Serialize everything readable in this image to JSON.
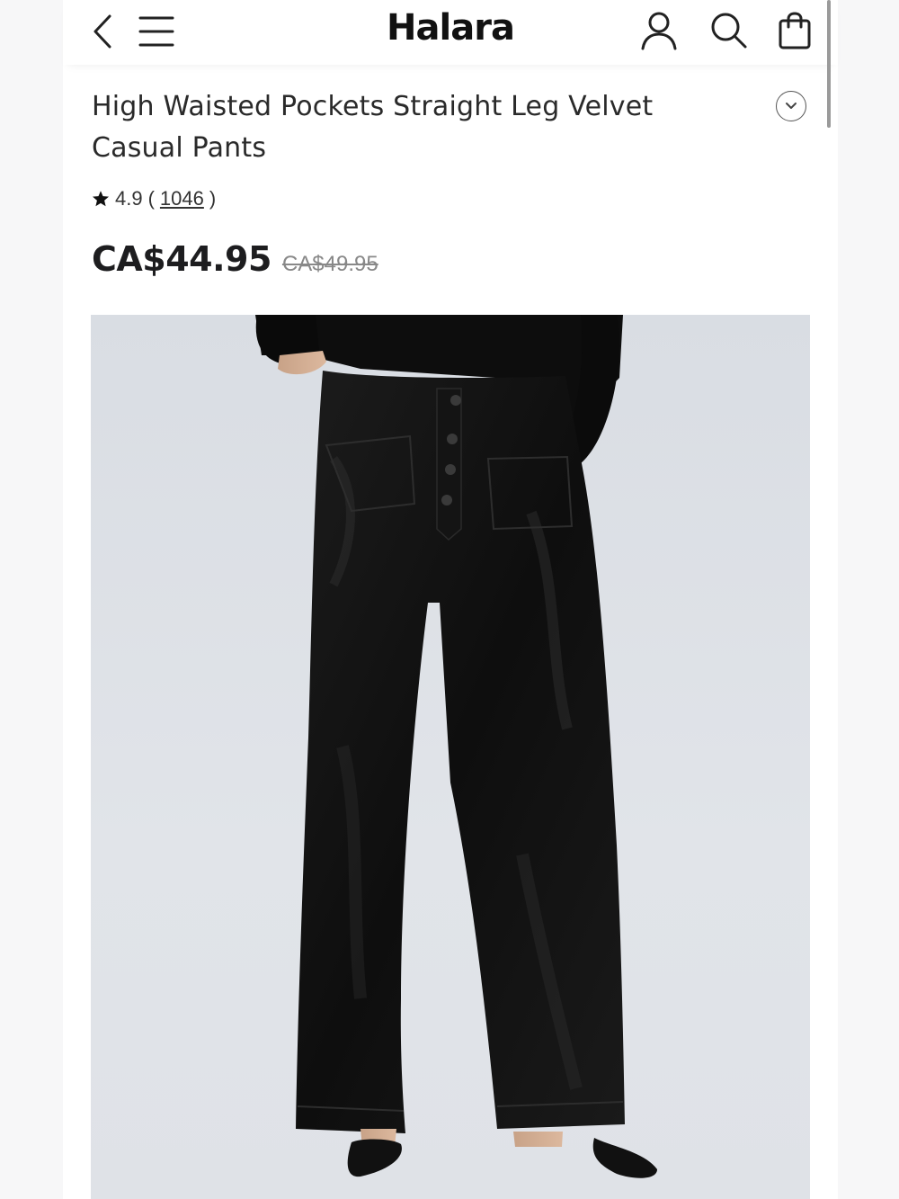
{
  "header": {
    "brand": "Halara",
    "icons": [
      "back-icon",
      "menu-icon",
      "account-icon",
      "search-icon",
      "shopping-bag-icon"
    ]
  },
  "product": {
    "title": "High Waisted Pockets Straight Leg Velvet Casual Pants",
    "rating": "4.9",
    "review_open": "(",
    "review_count": "1046",
    "review_close": ")",
    "price": "CA$44.95",
    "original_price": "CA$49.95"
  },
  "colors": {
    "accent": "#1d1d1f",
    "strikethrough": "#888888",
    "image_background": "#dcdfe4"
  }
}
